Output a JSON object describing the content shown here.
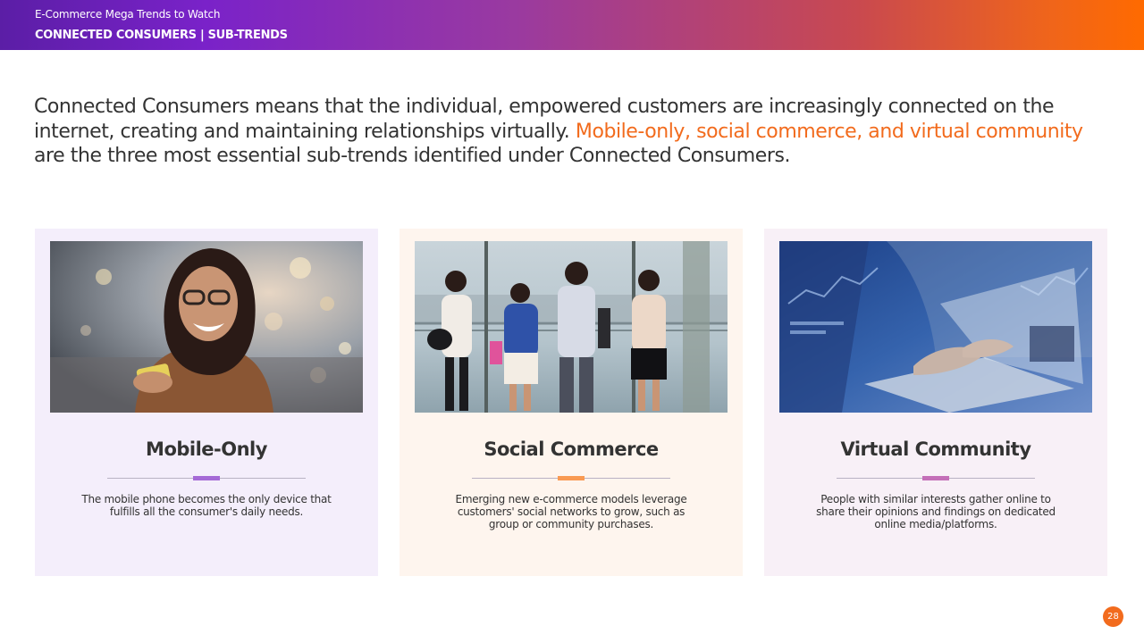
{
  "header": {
    "kicker": "E-Commerce Mega Trends to Watch",
    "section": "CONNECTED CONSUMERS | SUB-TRENDS"
  },
  "intro": {
    "text_before": "Connected Consumers means that the individual, empowered customers are increasingly connected on the internet, creating and maintaining relationships virtually. ",
    "highlight": "Mobile-only, social commerce, and virtual community",
    "text_after": " are the three most essential sub-trends identified under Connected Consumers."
  },
  "cards": [
    {
      "title": "Mobile-Only",
      "description": "The mobile phone becomes the only device that fulfills all the consumer's daily needs.",
      "image_icon": "woman-smiling-with-phone-photo",
      "accent_color": "#a56ad6"
    },
    {
      "title": "Social Commerce",
      "description": "Emerging new e-commerce models leverage customers' social networks to grow, such as group or community purchases.",
      "image_icon": "people-looking-at-phones-photo",
      "accent_color": "#f99a52"
    },
    {
      "title": "Virtual Community",
      "description": "People with similar interests gather online to share their opinions and findings on dedicated online media/platforms.",
      "image_icon": "hands-typing-laptop-photo",
      "accent_color": "#c46fb8"
    }
  ],
  "page_number": "28",
  "colors": {
    "highlight": "#f26b1d",
    "header_gradient_start": "#5b1ea6",
    "header_gradient_end": "#ff6a00"
  }
}
